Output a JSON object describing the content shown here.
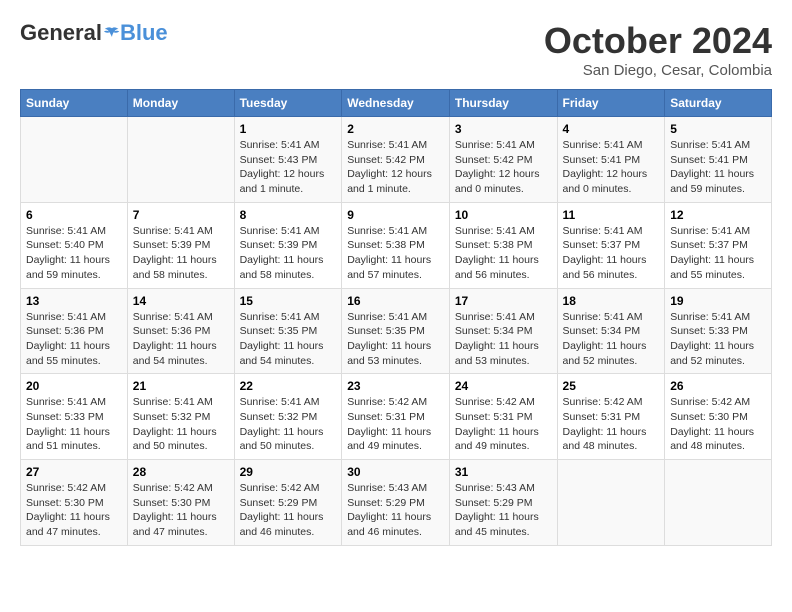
{
  "logo": {
    "general": "General",
    "blue": "Blue"
  },
  "title": "October 2024",
  "subtitle": "San Diego, Cesar, Colombia",
  "days_header": [
    "Sunday",
    "Monday",
    "Tuesday",
    "Wednesday",
    "Thursday",
    "Friday",
    "Saturday"
  ],
  "weeks": [
    [
      {
        "day": "",
        "content": ""
      },
      {
        "day": "",
        "content": ""
      },
      {
        "day": "1",
        "content": "Sunrise: 5:41 AM\nSunset: 5:43 PM\nDaylight: 12 hours\nand 1 minute."
      },
      {
        "day": "2",
        "content": "Sunrise: 5:41 AM\nSunset: 5:42 PM\nDaylight: 12 hours\nand 1 minute."
      },
      {
        "day": "3",
        "content": "Sunrise: 5:41 AM\nSunset: 5:42 PM\nDaylight: 12 hours\nand 0 minutes."
      },
      {
        "day": "4",
        "content": "Sunrise: 5:41 AM\nSunset: 5:41 PM\nDaylight: 12 hours\nand 0 minutes."
      },
      {
        "day": "5",
        "content": "Sunrise: 5:41 AM\nSunset: 5:41 PM\nDaylight: 11 hours\nand 59 minutes."
      }
    ],
    [
      {
        "day": "6",
        "content": "Sunrise: 5:41 AM\nSunset: 5:40 PM\nDaylight: 11 hours\nand 59 minutes."
      },
      {
        "day": "7",
        "content": "Sunrise: 5:41 AM\nSunset: 5:39 PM\nDaylight: 11 hours\nand 58 minutes."
      },
      {
        "day": "8",
        "content": "Sunrise: 5:41 AM\nSunset: 5:39 PM\nDaylight: 11 hours\nand 58 minutes."
      },
      {
        "day": "9",
        "content": "Sunrise: 5:41 AM\nSunset: 5:38 PM\nDaylight: 11 hours\nand 57 minutes."
      },
      {
        "day": "10",
        "content": "Sunrise: 5:41 AM\nSunset: 5:38 PM\nDaylight: 11 hours\nand 56 minutes."
      },
      {
        "day": "11",
        "content": "Sunrise: 5:41 AM\nSunset: 5:37 PM\nDaylight: 11 hours\nand 56 minutes."
      },
      {
        "day": "12",
        "content": "Sunrise: 5:41 AM\nSunset: 5:37 PM\nDaylight: 11 hours\nand 55 minutes."
      }
    ],
    [
      {
        "day": "13",
        "content": "Sunrise: 5:41 AM\nSunset: 5:36 PM\nDaylight: 11 hours\nand 55 minutes."
      },
      {
        "day": "14",
        "content": "Sunrise: 5:41 AM\nSunset: 5:36 PM\nDaylight: 11 hours\nand 54 minutes."
      },
      {
        "day": "15",
        "content": "Sunrise: 5:41 AM\nSunset: 5:35 PM\nDaylight: 11 hours\nand 54 minutes."
      },
      {
        "day": "16",
        "content": "Sunrise: 5:41 AM\nSunset: 5:35 PM\nDaylight: 11 hours\nand 53 minutes."
      },
      {
        "day": "17",
        "content": "Sunrise: 5:41 AM\nSunset: 5:34 PM\nDaylight: 11 hours\nand 53 minutes."
      },
      {
        "day": "18",
        "content": "Sunrise: 5:41 AM\nSunset: 5:34 PM\nDaylight: 11 hours\nand 52 minutes."
      },
      {
        "day": "19",
        "content": "Sunrise: 5:41 AM\nSunset: 5:33 PM\nDaylight: 11 hours\nand 52 minutes."
      }
    ],
    [
      {
        "day": "20",
        "content": "Sunrise: 5:41 AM\nSunset: 5:33 PM\nDaylight: 11 hours\nand 51 minutes."
      },
      {
        "day": "21",
        "content": "Sunrise: 5:41 AM\nSunset: 5:32 PM\nDaylight: 11 hours\nand 50 minutes."
      },
      {
        "day": "22",
        "content": "Sunrise: 5:41 AM\nSunset: 5:32 PM\nDaylight: 11 hours\nand 50 minutes."
      },
      {
        "day": "23",
        "content": "Sunrise: 5:42 AM\nSunset: 5:31 PM\nDaylight: 11 hours\nand 49 minutes."
      },
      {
        "day": "24",
        "content": "Sunrise: 5:42 AM\nSunset: 5:31 PM\nDaylight: 11 hours\nand 49 minutes."
      },
      {
        "day": "25",
        "content": "Sunrise: 5:42 AM\nSunset: 5:31 PM\nDaylight: 11 hours\nand 48 minutes."
      },
      {
        "day": "26",
        "content": "Sunrise: 5:42 AM\nSunset: 5:30 PM\nDaylight: 11 hours\nand 48 minutes."
      }
    ],
    [
      {
        "day": "27",
        "content": "Sunrise: 5:42 AM\nSunset: 5:30 PM\nDaylight: 11 hours\nand 47 minutes."
      },
      {
        "day": "28",
        "content": "Sunrise: 5:42 AM\nSunset: 5:30 PM\nDaylight: 11 hours\nand 47 minutes."
      },
      {
        "day": "29",
        "content": "Sunrise: 5:42 AM\nSunset: 5:29 PM\nDaylight: 11 hours\nand 46 minutes."
      },
      {
        "day": "30",
        "content": "Sunrise: 5:43 AM\nSunset: 5:29 PM\nDaylight: 11 hours\nand 46 minutes."
      },
      {
        "day": "31",
        "content": "Sunrise: 5:43 AM\nSunset: 5:29 PM\nDaylight: 11 hours\nand 45 minutes."
      },
      {
        "day": "",
        "content": ""
      },
      {
        "day": "",
        "content": ""
      }
    ]
  ]
}
